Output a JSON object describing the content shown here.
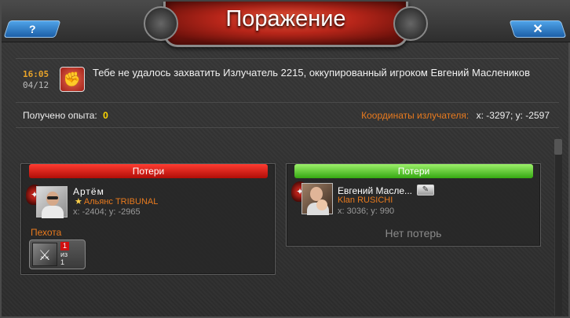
{
  "window": {
    "title": "Поражение",
    "help_label": "?",
    "close_label": "✕"
  },
  "message": {
    "time": "16:05",
    "date": "04/12",
    "icon": "defeat-icon",
    "text": "Тебе не удалось захватить Излучатель 2215, оккупированный игроком Евгений Маслеников"
  },
  "stats": {
    "exp_label": "Получено опыта:",
    "exp_value": "0",
    "coords_label": "Координаты излучателя:",
    "coords_value": "x: -3297; y: -2597"
  },
  "attacker": {
    "header": "Потери",
    "header_color": "#d01010",
    "name": "Артём",
    "alliance": "Альянс TRIBUNAL",
    "coords": "x: -2404; y: -2965",
    "category": "Пехота",
    "unit": {
      "icon": "infantry-icon",
      "lost": "1",
      "of_label": "из",
      "total": "1"
    }
  },
  "defender": {
    "header": "Потери",
    "header_color": "#35a812",
    "name": "Евгений Масле...",
    "alliance": "Klan RUSICHI",
    "coords": "x: 3036; y: 990",
    "no_losses": "Нет потерь"
  }
}
